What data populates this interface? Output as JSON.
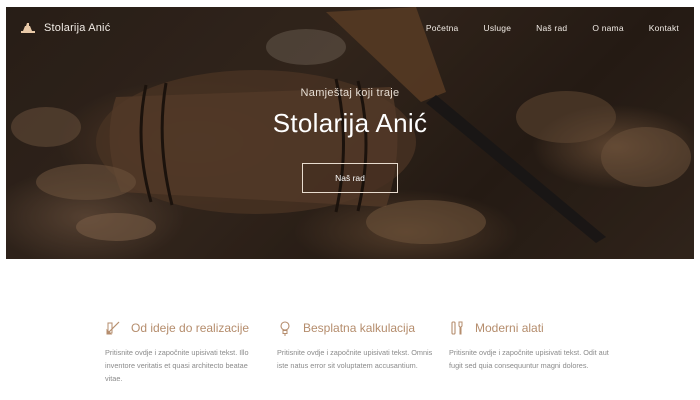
{
  "brand": {
    "name": "Stolarija Anić",
    "icon": "carpentry-plane-icon"
  },
  "nav": {
    "items": [
      {
        "label": "Početna"
      },
      {
        "label": "Usluge"
      },
      {
        "label": "Naš rad"
      },
      {
        "label": "O nama"
      },
      {
        "label": "Kontakt"
      }
    ]
  },
  "hero": {
    "subtitle": "Namještaj koji traje",
    "title": "Stolarija Anić",
    "button_label": "Naš rad"
  },
  "features": [
    {
      "icon": "pencil-ruler-icon",
      "title": "Od ideje do realizacije",
      "text": "Pritisnite ovdje i započnite upisivati tekst. Illo inventore veritatis et quasi architecto beatae vitae."
    },
    {
      "icon": "lightbulb-icon",
      "title": "Besplatna kalkulacija",
      "text": "Pritisnite ovdje i započnite upisivati tekst. Omnis iste natus error sit voluptatem accusantium."
    },
    {
      "icon": "tools-icon",
      "title": "Moderni alati",
      "text": "Pritisnite ovdje i započnite upisivati tekst. Odit aut fugit sed quia consequuntur magni dolores."
    }
  ],
  "colors": {
    "accent": "#b58d6d",
    "hero_text": "#ffffff",
    "body_text": "#8b8b8b"
  }
}
